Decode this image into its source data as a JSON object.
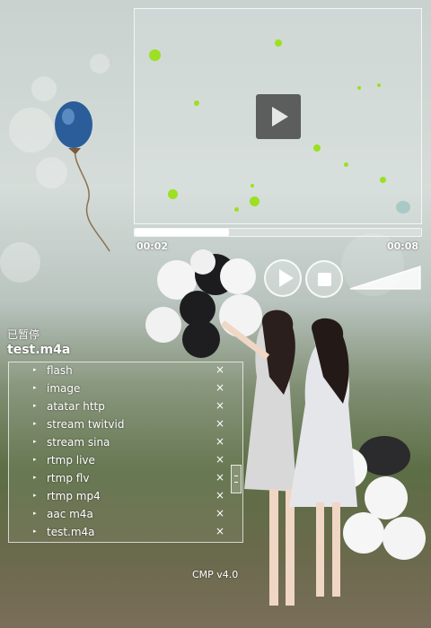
{
  "player": {
    "status": "已暂停",
    "current_title": "test.m4a",
    "time_elapsed": "00:02",
    "time_total": "00:08",
    "progress": 0.33,
    "volume": 1.0,
    "version": "CMP v4.0"
  },
  "playlist": {
    "items": [
      {
        "label": "flash"
      },
      {
        "label": "image"
      },
      {
        "label": "atatar http"
      },
      {
        "label": "stream twitvid"
      },
      {
        "label": "stream sina"
      },
      {
        "label": "rtmp live"
      },
      {
        "label": "rtmp flv"
      },
      {
        "label": "rtmp mp4"
      },
      {
        "label": "aac m4a"
      },
      {
        "label": "test.m4a"
      }
    ],
    "close_glyph": "×",
    "arrow_glyph": "▸"
  },
  "icons": {
    "play": "play-icon",
    "stop": "stop-icon",
    "volume": "volume-icon",
    "close": "close-icon",
    "arrow": "arrow-icon"
  },
  "colors": {
    "accent": "#9be022",
    "text": "#ffffff"
  }
}
